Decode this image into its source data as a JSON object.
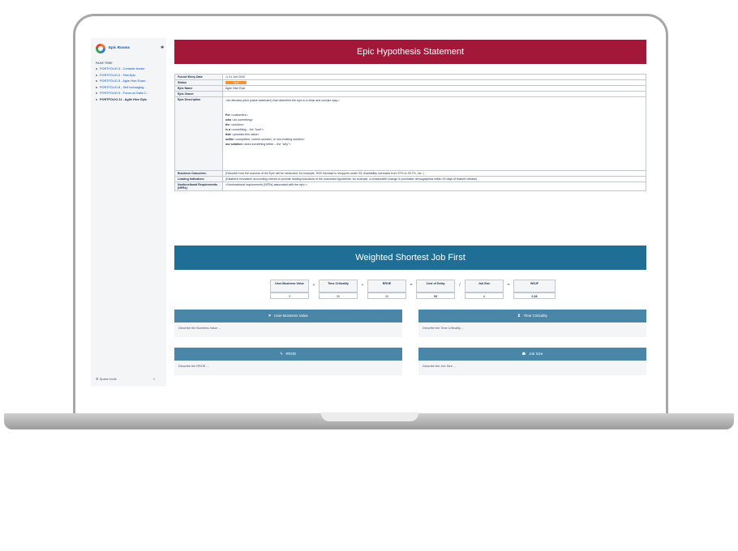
{
  "sidebar": {
    "space_name": "Epic Rooms",
    "pin_icon": "pin-icon",
    "section_label": "PAGE TREE",
    "items": [
      {
        "label": "PORTFOLIO-3 - Consider tender"
      },
      {
        "label": "PORTFOLIO-2 - Test-Epic"
      },
      {
        "label": "PORTFOLIO-5 - Agile Hive Exam..."
      },
      {
        "label": "PORTFOLIO-8 - Self recharging..."
      },
      {
        "label": "PORTFOLIO-9 - Focus on Data C..."
      },
      {
        "label": "PORTFOLIO-11 - Agile Hive Epic"
      }
    ],
    "footer_label": "Space tools",
    "footer_chevron": "«"
  },
  "epic": {
    "banner_title": "Epic Hypothesis Statement",
    "rows": {
      "funnel_label": "Funnel Entry Date",
      "funnel_value": "01 Jun 2020",
      "status_label": "Status",
      "status_value": "NEW",
      "name_label": "Epic Name",
      "name_value": "Agile Hive Epic",
      "owner_label": "Epic Owner",
      "owner_value": "",
      "description_label": "Epic Description",
      "description_intro": "<An elevator pitch (value statement) that describes the epic in a clear and concise way.>",
      "desc_for_kw": "For",
      "desc_for": " <customers>",
      "desc_who_kw": "who",
      "desc_who": " <do something>",
      "desc_the_kw": "the",
      "desc_the": " <solution>",
      "desc_isa_kw": "is a",
      "desc_isa": " <something – the \"how\">",
      "desc_that_kw": "that",
      "desc_that": " <provides this value>",
      "desc_unlike_kw": "unlike",
      "desc_unlike": " <competitor, current solution, or non-existing solution>",
      "desc_our_kw": "our solution",
      "desc_our": " <does something better – the \"why\">",
      "outcomes_label": "Business Outcomes:",
      "outcomes_value": "(Describe how the success of the Epic will be measured: for example, 50% increase in shoppers under 25; Availability increases from 97% to 99.7%, etc. )",
      "indicators_label": "Leading Indicators:",
      "indicators_value": "(Establish innovation accounting metrics to provide leading indicators of the outcomes hypothesis: for example, a measurable change in purchaser demographics within 30 days of feature release)",
      "nfr_label": "Nonfunctional Requirements (NFRs)",
      "nfr_value": "<Nonfunctional requirements (NFRs) associated with the epic.>"
    }
  },
  "wsjf": {
    "banner_title": "Weighted Shortest Job First",
    "headers": [
      "User-Business Value",
      "Time Criticality",
      "RROE",
      "Cost of Delay",
      "Job Size",
      "WSJF"
    ],
    "values": [
      "3",
      "30",
      "20",
      "53",
      "8",
      "6.38"
    ],
    "operators": [
      "+",
      "+",
      "=",
      "/",
      "="
    ]
  },
  "panels": {
    "ubv": {
      "title": "User-Business Value",
      "icon": "heart-icon",
      "glyph": "♥",
      "body": "Describe the Business Value ..."
    },
    "tc": {
      "title": "Time Criticality",
      "icon": "hourglass-icon",
      "glyph": "⧗",
      "body": "Describe the Time Criticality ..."
    },
    "rroe": {
      "title": "RROE",
      "icon": "lightning-icon",
      "glyph": "ϟ",
      "body": "Describe the RROE ..."
    },
    "js": {
      "title": "Job Size",
      "icon": "weight-icon",
      "glyph": "☗",
      "body": "Describe the Job Size ..."
    }
  }
}
